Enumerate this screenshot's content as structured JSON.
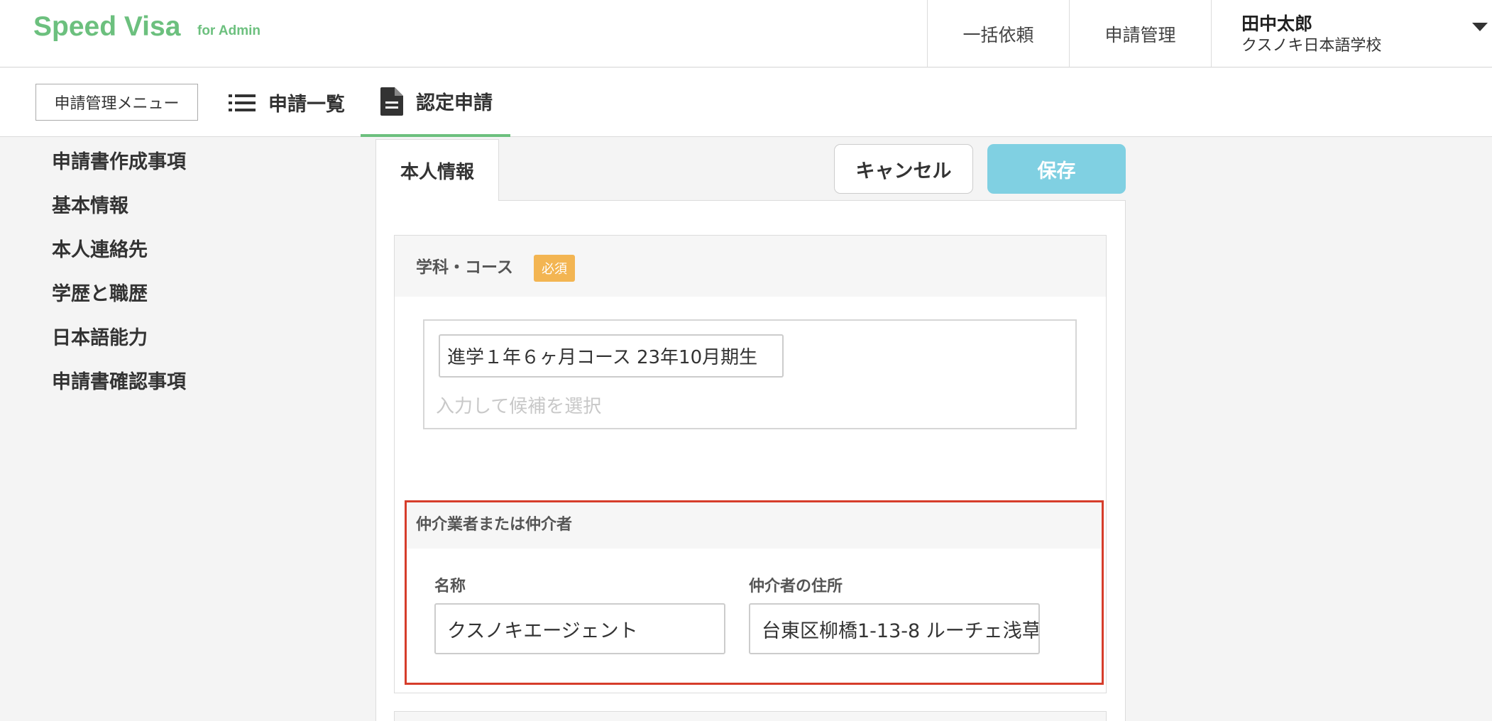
{
  "brand": {
    "name": "Speed Visa",
    "sub": "for Admin",
    "color": "#6cc07e"
  },
  "header": {
    "nav": [
      "一括依頼",
      "申請管理"
    ],
    "user": {
      "name": "田中太郎",
      "school": "クスノキ日本語学校"
    }
  },
  "subnav": {
    "menu_label": "申請管理メニュー",
    "tabs": [
      {
        "label": "申請一覧",
        "icon": "list-icon"
      },
      {
        "label": "認定申請",
        "icon": "document-icon"
      }
    ]
  },
  "sidebar": {
    "items": [
      "申請書作成事項",
      "基本情報",
      "本人連絡先",
      "学歴と職歴",
      "日本語能力",
      "申請書確認事項"
    ]
  },
  "form": {
    "tab": "本人情報",
    "cancel_label": "キャンセル",
    "save_label": "保存",
    "course": {
      "title": "学科・コース",
      "required_label": "必須",
      "selected": "進学１年６ヶ月コース 23年10月期生",
      "placeholder": "入力して候補を選択"
    },
    "agent": {
      "title": "仲介業者または仲介者",
      "name_label": "名称",
      "name_value": "クスノキエージェント",
      "address_label": "仲介者の住所",
      "address_value": "台東区柳橋1-13-8 ルーチェ浅草"
    }
  },
  "colors": {
    "save": "#80d0e2",
    "badge": "#f3b552",
    "highlight": "#d63d2b"
  }
}
